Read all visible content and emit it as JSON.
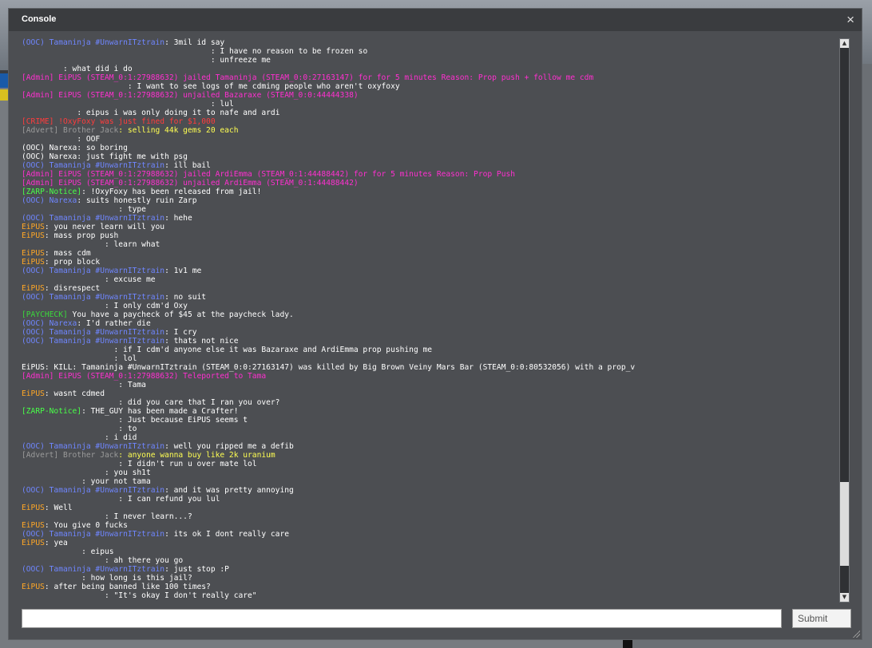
{
  "window": {
    "title": "Console",
    "close_glyph": "×"
  },
  "input": {
    "value": "",
    "placeholder": ""
  },
  "submit_label": "Submit",
  "log": [
    {
      "parts": [
        [
          "(OOC) ",
          "tag-ooc"
        ],
        [
          "Tamaninja #UnwarnITztrain",
          "name-blue"
        ],
        [
          ": 3mil id say",
          "plain"
        ]
      ]
    },
    {
      "parts": [
        [
          "                    ",
          "ghost"
        ],
        [
          "                    ",
          "plain"
        ],
        [
          " : I have no reason to be frozen so",
          "plain"
        ]
      ]
    },
    {
      "parts": [
        [
          "                    ",
          "ghost"
        ],
        [
          "                    ",
          "plain"
        ],
        [
          " : unfreeze me",
          "plain"
        ]
      ]
    },
    {
      "parts": [
        [
          "       ",
          "ghost"
        ],
        [
          "  : what did i do",
          "plain"
        ]
      ]
    },
    {
      "parts": [
        [
          "[Admin] EiPUS (STEAM_0:1:27988632) jailed ",
          "admin"
        ],
        [
          "Tamaninja (STEAM_0:0:27163147) for for 5 minutes Reason: Prop push + follow me cdm",
          "admin"
        ]
      ]
    },
    {
      "parts": [
        [
          "                      ",
          "ghost"
        ],
        [
          " : I want to see logs of me cdming people who aren't oxyfoxy",
          "plain"
        ]
      ]
    },
    {
      "parts": [
        [
          "[Admin] EiPUS (STEAM_0:1:27988632) unjailed Bazaraxe (STEAM_0:0:44444338)",
          "admin"
        ]
      ]
    },
    {
      "parts": [
        [
          "                    ",
          "ghost"
        ],
        [
          "                    ",
          "plain"
        ],
        [
          " : lul",
          "plain"
        ]
      ]
    },
    {
      "parts": [
        [
          "           ",
          "ghost"
        ],
        [
          " : eipus i was only doing it to nafe and ardi",
          "plain"
        ]
      ]
    },
    {
      "parts": [
        [
          "[CRIME] !OxyFoxy was just fined for $1,000",
          "crime"
        ]
      ]
    },
    {
      "parts": [
        [
          "[Advert] Brother Jack",
          "advert-tag"
        ],
        [
          ": selling 44k gems 20 each",
          "advert-msg"
        ]
      ]
    },
    {
      "parts": [
        [
          "           ",
          "ghost"
        ],
        [
          " : OOF",
          "plain"
        ]
      ]
    },
    {
      "parts": [
        [
          "(OOC) Narexa: so boring",
          "plain"
        ]
      ]
    },
    {
      "parts": [
        [
          "(OOC) Narexa: just fight me with psg",
          "plain"
        ]
      ]
    },
    {
      "parts": [
        [
          "(OOC) ",
          "tag-ooc"
        ],
        [
          "Tamaninja #UnwarnITztrain",
          "name-blue"
        ],
        [
          ": ill bail",
          "plain"
        ]
      ]
    },
    {
      "parts": [
        [
          "[Admin] EiPUS (STEAM_0:1:27988632) jailed ArdiEmma (STEAM_0:1:44488442) for for 5 minutes Reason: Prop Push",
          "admin"
        ]
      ]
    },
    {
      "parts": [
        [
          "[Admin] EiPUS (STEAM_0:1:27988632) unjailed ArdiEmma (STEAM_0:1:44488442)",
          "admin"
        ]
      ]
    },
    {
      "parts": [
        [
          "[ZARP-Notice]",
          "notice"
        ],
        [
          ": !OxyFoxy has been released from jail!",
          "plain"
        ]
      ]
    },
    {
      "parts": [
        [
          "(OOC) ",
          "tag-ooc"
        ],
        [
          "Narexa",
          "name-blue"
        ],
        [
          ": suits honestly ruin Zarp",
          "plain"
        ]
      ]
    },
    {
      "parts": [
        [
          "                 ",
          "ghost"
        ],
        [
          "    : type",
          "plain"
        ]
      ]
    },
    {
      "parts": [
        [
          "(OOC) ",
          "tag-ooc"
        ],
        [
          "Tamaninja #UnwarnITztrain",
          "name-blue"
        ],
        [
          ": hehe",
          "plain"
        ]
      ]
    },
    {
      "parts": [
        [
          "EiPUS",
          "name-orange"
        ],
        [
          ": you never learn will you",
          "plain"
        ]
      ]
    },
    {
      "parts": [
        [
          "EiPUS",
          "name-orange"
        ],
        [
          ": mass prop push",
          "plain"
        ]
      ]
    },
    {
      "parts": [
        [
          "                 ",
          "ghost"
        ],
        [
          " : learn what",
          "plain"
        ]
      ]
    },
    {
      "parts": [
        [
          "EiPUS",
          "name-orange"
        ],
        [
          ": mass cdm",
          "plain"
        ]
      ]
    },
    {
      "parts": [
        [
          "EiPUS",
          "name-orange"
        ],
        [
          ": prop block",
          "plain"
        ]
      ]
    },
    {
      "parts": [
        [
          "(OOC) ",
          "tag-ooc"
        ],
        [
          "Tamaninja #UnwarnITztrain",
          "name-blue"
        ],
        [
          ": 1v1 me",
          "plain"
        ]
      ]
    },
    {
      "parts": [
        [
          "                 ",
          "ghost"
        ],
        [
          " : excuse me",
          "plain"
        ]
      ]
    },
    {
      "parts": [
        [
          "EiPUS",
          "name-orange"
        ],
        [
          ": disrespect",
          "plain"
        ]
      ]
    },
    {
      "parts": [
        [
          "(OOC) ",
          "tag-ooc"
        ],
        [
          "Tamaninja #UnwarnITztrain",
          "name-blue"
        ],
        [
          ": no suit",
          "plain"
        ]
      ]
    },
    {
      "parts": [
        [
          "                 ",
          "ghost"
        ],
        [
          " : I only cdm'd Oxy",
          "plain"
        ]
      ]
    },
    {
      "parts": [
        [
          "[PAYCHECK]",
          "pay"
        ],
        [
          " You have a paycheck of $45 at the paycheck lady.",
          "plain"
        ]
      ]
    },
    {
      "parts": [
        [
          "(OOC) ",
          "tag-ooc"
        ],
        [
          "Narexa",
          "name-blue"
        ],
        [
          ": I'd rather die",
          "plain"
        ]
      ]
    },
    {
      "parts": [
        [
          "(OOC) ",
          "tag-ooc"
        ],
        [
          "Tamaninja #UnwarnITztrain",
          "name-blue"
        ],
        [
          ": I cry",
          "plain"
        ]
      ]
    },
    {
      "parts": [
        [
          "(OOC) ",
          "tag-ooc"
        ],
        [
          "Tamaninja #UnwarnITztrain",
          "name-blue"
        ],
        [
          ": thats not nice",
          "plain"
        ]
      ]
    },
    {
      "parts": [
        [
          "                  ",
          "ghost"
        ],
        [
          "  : if I cdm'd anyone else it was Bazaraxe and ArdiEmma prop pushing me",
          "plain"
        ]
      ]
    },
    {
      "parts": [
        [
          "                  ",
          "ghost"
        ],
        [
          "  : lol",
          "plain"
        ]
      ]
    },
    {
      "parts": [
        [
          "EiPUS",
          "plain"
        ],
        [
          ": KILL: Tamaninja #UnwarnITztrain (STEAM_0:0:27163147) was killed by Big Brown Veiny Mars Bar (STEAM_0:0:80532056) with a prop_v",
          "plain"
        ]
      ]
    },
    {
      "parts": [
        [
          "[Admin] EiPUS (STEAM_0:1:27988632) Teleported to Tama",
          "admin"
        ]
      ]
    },
    {
      "parts": [
        [
          "                   ",
          "ghost"
        ],
        [
          "  : Tama",
          "plain"
        ]
      ]
    },
    {
      "parts": [
        [
          "EiPUS",
          "name-orange"
        ],
        [
          ": wasnt cdmed",
          "plain"
        ]
      ]
    },
    {
      "parts": [
        [
          "                   ",
          "ghost"
        ],
        [
          "  : did you care that I ran you over?",
          "plain"
        ]
      ]
    },
    {
      "parts": [
        [
          "[ZARP-Notice]",
          "notice"
        ],
        [
          ": THE_GUY has been made a Crafter!",
          "plain"
        ]
      ]
    },
    {
      "parts": [
        [
          "                   ",
          "ghost"
        ],
        [
          "  : Just because EiPUS seems t",
          "plain"
        ]
      ]
    },
    {
      "parts": [
        [
          "                   ",
          "ghost"
        ],
        [
          "  : to",
          "plain"
        ]
      ]
    },
    {
      "parts": [
        [
          "                ",
          "ghost"
        ],
        [
          "  : i did",
          "plain"
        ]
      ]
    },
    {
      "parts": [
        [
          "(OOC) ",
          "tag-ooc"
        ],
        [
          "Tamaninja #UnwarnITztrain",
          "name-blue"
        ],
        [
          ": well you ripped me a defib",
          "plain"
        ]
      ]
    },
    {
      "parts": [
        [
          "[Advert] Brother Jack",
          "advert-tag"
        ],
        [
          ": anyone wanna buy like 2k uranium",
          "advert-msg"
        ]
      ]
    },
    {
      "parts": [
        [
          "                   ",
          "ghost"
        ],
        [
          "  : I didn't run u over mate lol",
          "plain"
        ]
      ]
    },
    {
      "parts": [
        [
          "                ",
          "ghost"
        ],
        [
          "  : you sh1t",
          "plain"
        ]
      ]
    },
    {
      "parts": [
        [
          "           ",
          "ghost"
        ],
        [
          "  : your not tama",
          "plain"
        ]
      ]
    },
    {
      "parts": [
        [
          "(OOC) ",
          "tag-ooc"
        ],
        [
          "Tamaninja #UnwarnITztrain",
          "name-blue"
        ],
        [
          ": and it was pretty annoying",
          "plain"
        ]
      ]
    },
    {
      "parts": [
        [
          "                   ",
          "ghost"
        ],
        [
          "  : I can refund you lul",
          "plain"
        ]
      ]
    },
    {
      "parts": [
        [
          "EiPUS",
          "name-orange"
        ],
        [
          ": Well",
          "plain"
        ]
      ]
    },
    {
      "parts": [
        [
          "                ",
          "ghost"
        ],
        [
          "  : I never learn...?",
          "plain"
        ]
      ]
    },
    {
      "parts": [
        [
          "EiPUS",
          "name-orange"
        ],
        [
          ": You give 0 fucks",
          "plain"
        ]
      ]
    },
    {
      "parts": [
        [
          "(OOC) ",
          "tag-ooc"
        ],
        [
          "Tamaninja #UnwarnITztrain",
          "name-blue"
        ],
        [
          ": its ok I dont really care",
          "plain"
        ]
      ]
    },
    {
      "parts": [
        [
          "EiPUS",
          "name-orange"
        ],
        [
          ": yea",
          "plain"
        ]
      ]
    },
    {
      "parts": [
        [
          "           ",
          "ghost"
        ],
        [
          "  : eipus",
          "plain"
        ]
      ]
    },
    {
      "parts": [
        [
          "                ",
          "ghost"
        ],
        [
          "  : ah there you go",
          "plain"
        ]
      ]
    },
    {
      "parts": [
        [
          "(OOC) ",
          "tag-ooc"
        ],
        [
          "Tamaninja #UnwarnITztrain",
          "name-blue"
        ],
        [
          ": just stop :P",
          "plain"
        ]
      ]
    },
    {
      "parts": [
        [
          "           ",
          "ghost"
        ],
        [
          "  : how long is this jail?",
          "plain"
        ]
      ]
    },
    {
      "parts": [
        [
          "EiPUS",
          "name-orange"
        ],
        [
          ": after being banned like 100 times?",
          "plain"
        ]
      ]
    },
    {
      "parts": [
        [
          "                ",
          "ghost"
        ],
        [
          "  : \"It's okay I don't really care\"",
          "plain"
        ]
      ]
    }
  ]
}
